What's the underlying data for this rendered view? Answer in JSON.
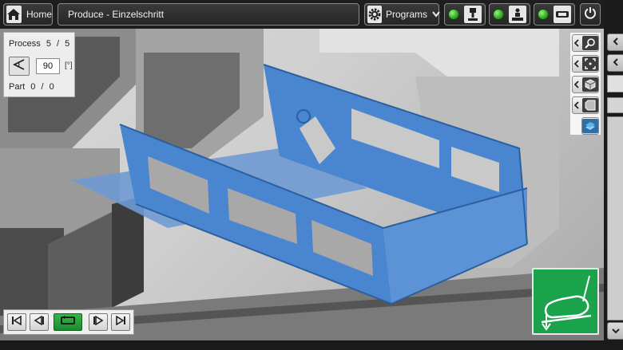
{
  "header": {
    "home_label": "Home",
    "title": "Produce - Einzelschritt",
    "programs_label": "Programs"
  },
  "status": {
    "led_color": "#2fa81f",
    "items": [
      {
        "icon": "press-tool-icon"
      },
      {
        "icon": "operator-station-icon"
      },
      {
        "icon": "backgauge-icon"
      }
    ]
  },
  "process": {
    "label": "Process",
    "current": "5",
    "separator": "/",
    "total": "5",
    "angle_value": "90",
    "angle_unit": "[°]",
    "part_label": "Part",
    "part_current": "0",
    "part_separator": "/",
    "part_total": "0"
  },
  "view_tools": [
    {
      "icon": "zoom-icon"
    },
    {
      "icon": "fit-view-icon"
    },
    {
      "icon": "view-cube-icon"
    },
    {
      "icon": "side-view-icon"
    },
    {
      "icon": "render-mode-icon"
    }
  ],
  "playback": {
    "buttons": [
      "first-step",
      "previous-step",
      "cycle",
      "next-step",
      "last-step"
    ],
    "active_color": "#1d8a2f"
  },
  "colors": {
    "part_blue": "#4a86cf",
    "machine_dark": "#4b4b4b",
    "pedal_green": "#1aa34a"
  }
}
